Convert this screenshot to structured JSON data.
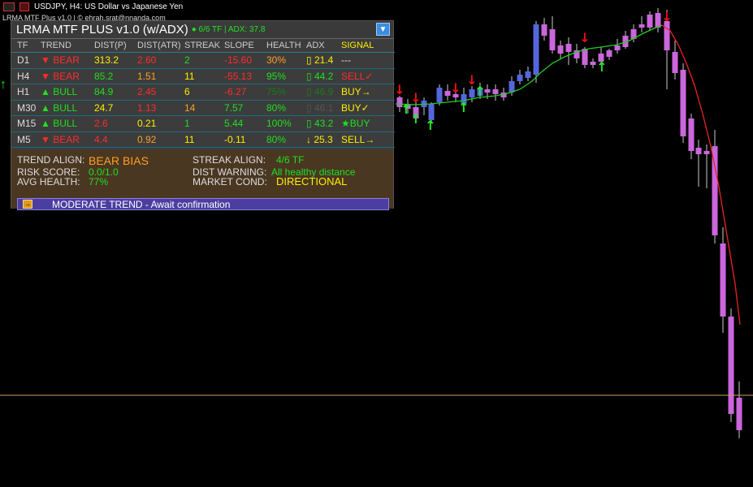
{
  "window": {
    "title": "USDJPY, H4:  US Dollar vs Japanese Yen",
    "indicator_label": "LRMA MTF Plus v1.0 | © ehrah.srat@nnanda.com"
  },
  "panel": {
    "title": "LRMA MTF PLUS v1.0 (w/ADX)",
    "subtitle": "● 6/6 TF | ADX: 37.8",
    "collapse_icon": "triangle-down-icon",
    "headers": [
      "TF",
      "TREND",
      "DIST(P)",
      "DIST(ATR)",
      "STREAK",
      "SLOPE",
      "HEALTH",
      "ADX",
      "SIGNAL"
    ],
    "rows": [
      {
        "tf": "D1",
        "trend": "▼ BEAR",
        "dist_p": "313.2",
        "dist_atr": "2.60",
        "streak": "2",
        "slope": "-15.60",
        "health": "30%",
        "adx": "▯ 21.4",
        "signal": "---"
      },
      {
        "tf": "H4",
        "trend": "▼ BEAR",
        "dist_p": "85.2",
        "dist_atr": "1.51",
        "streak": "11",
        "slope": "-55.13",
        "health": "95%",
        "adx": "▯ 44.2",
        "signal": "SELL✓"
      },
      {
        "tf": "H1",
        "trend": "▲ BULL",
        "dist_p": "84.9",
        "dist_atr": "2.45",
        "streak": "6",
        "slope": "-6.27",
        "health": "75%",
        "adx": "▯ 46.9",
        "signal": "BUY→"
      },
      {
        "tf": "M30",
        "trend": "▲ BULL",
        "dist_p": "24.7",
        "dist_atr": "1.13",
        "streak": "14",
        "slope": "7.57",
        "health": "80%",
        "adx": "▯ 46.1",
        "signal": "BUY✓"
      },
      {
        "tf": "M15",
        "trend": "▲ BULL",
        "dist_p": "2.6",
        "dist_atr": "0.21",
        "streak": "1",
        "slope": "5.44",
        "health": "100%",
        "adx": "▯ 43.2",
        "signal": "★BUY"
      },
      {
        "tf": "M5",
        "trend": "▼ BEAR",
        "dist_p": "4.4",
        "dist_atr": "0.92",
        "streak": "11",
        "slope": "-0.11",
        "health": "80%",
        "adx": "↓ 25.3",
        "signal": "SELL→"
      }
    ],
    "summary": {
      "trend_align_label": "TREND ALIGN:",
      "trend_align_value": "BEAR BIAS",
      "risk_score_label": "RISK SCORE:",
      "risk_score_value": "0.0/1.0",
      "avg_health_label": "AVG HEALTH:",
      "avg_health_value": "77%",
      "streak_align_label": "STREAK ALIGN:",
      "streak_align_value": "4/6 TF",
      "dist_warning_label": "DIST WARNING:",
      "dist_warning_value": "All healthy distance",
      "market_cond_label": "MARKET COND:",
      "market_cond_value": "DIRECTIONAL"
    },
    "banner_text": "MODERATE TREND - Await confirmation",
    "banner_icon": "arrow-right-box-icon"
  },
  "colors": {
    "bull_candle": "#5566dd",
    "bear_candle": "#cc66dd",
    "ma_bull": "#22cc22",
    "ma_bear": "#ee2222",
    "up_arrow": "#22ee22",
    "down_arrow": "#ee1111",
    "hline": "#c8a060"
  }
}
